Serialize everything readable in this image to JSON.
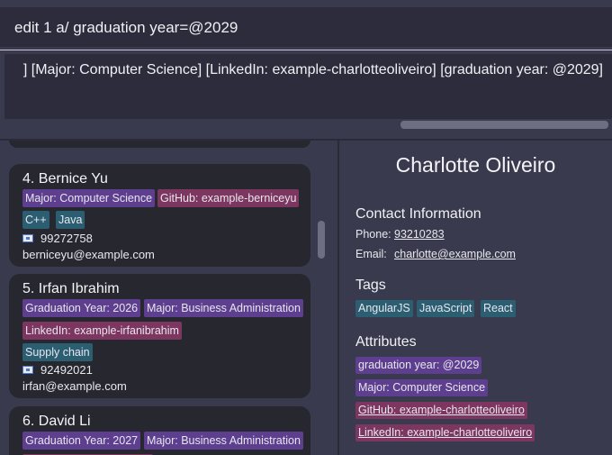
{
  "command": {
    "input_value": "edit 1 a/ graduation year=@2029"
  },
  "result": {
    "text": "] [Major: Computer Science] [LinkedIn: example-charlotteoliveiro] [graduation year: @2029]"
  },
  "person_list": [
    {
      "title": "4. Bernice Yu",
      "attributes": [
        "Major: Computer Science",
        "GitHub: example-berniceyu"
      ],
      "tags": [
        "C++",
        "Java"
      ],
      "phone": "99272758",
      "email": "berniceyu@example.com"
    },
    {
      "title": "5. Irfan Ibrahim",
      "attributes": [
        "Graduation Year: 2026",
        "Major: Business Administration",
        "LinkedIn: example-irfanibrahim"
      ],
      "tags": [
        "Supply chain"
      ],
      "phone": "92492021",
      "email": "irfan@example.com"
    },
    {
      "title": "6. David Li",
      "attributes": [
        "Graduation Year: 2027",
        "Major: Business Administration"
      ]
    }
  ],
  "detail": {
    "name": "Charlotte Oliveiro",
    "contact_title": "Contact Information",
    "phone_label": "Phone:",
    "phone_value": "93210283",
    "email_label": "Email:",
    "email_value": "charlotte@example.com",
    "tags_title": "Tags",
    "tags": [
      "AngularJS",
      "JavaScript",
      "React"
    ],
    "attributes_title": "Attributes",
    "attributes": [
      "graduation year: @2029",
      "Major: Computer Science",
      "GitHub: example-charlotteoliveiro",
      "LinkedIn: example-charlotteoliveiro"
    ]
  },
  "colors": {
    "background": "#3a3a4e",
    "card": "#27272f",
    "tag_purple": "#5e3e8e",
    "tag_pink": "#7c3660",
    "tag_teal": "#2c5e72"
  }
}
